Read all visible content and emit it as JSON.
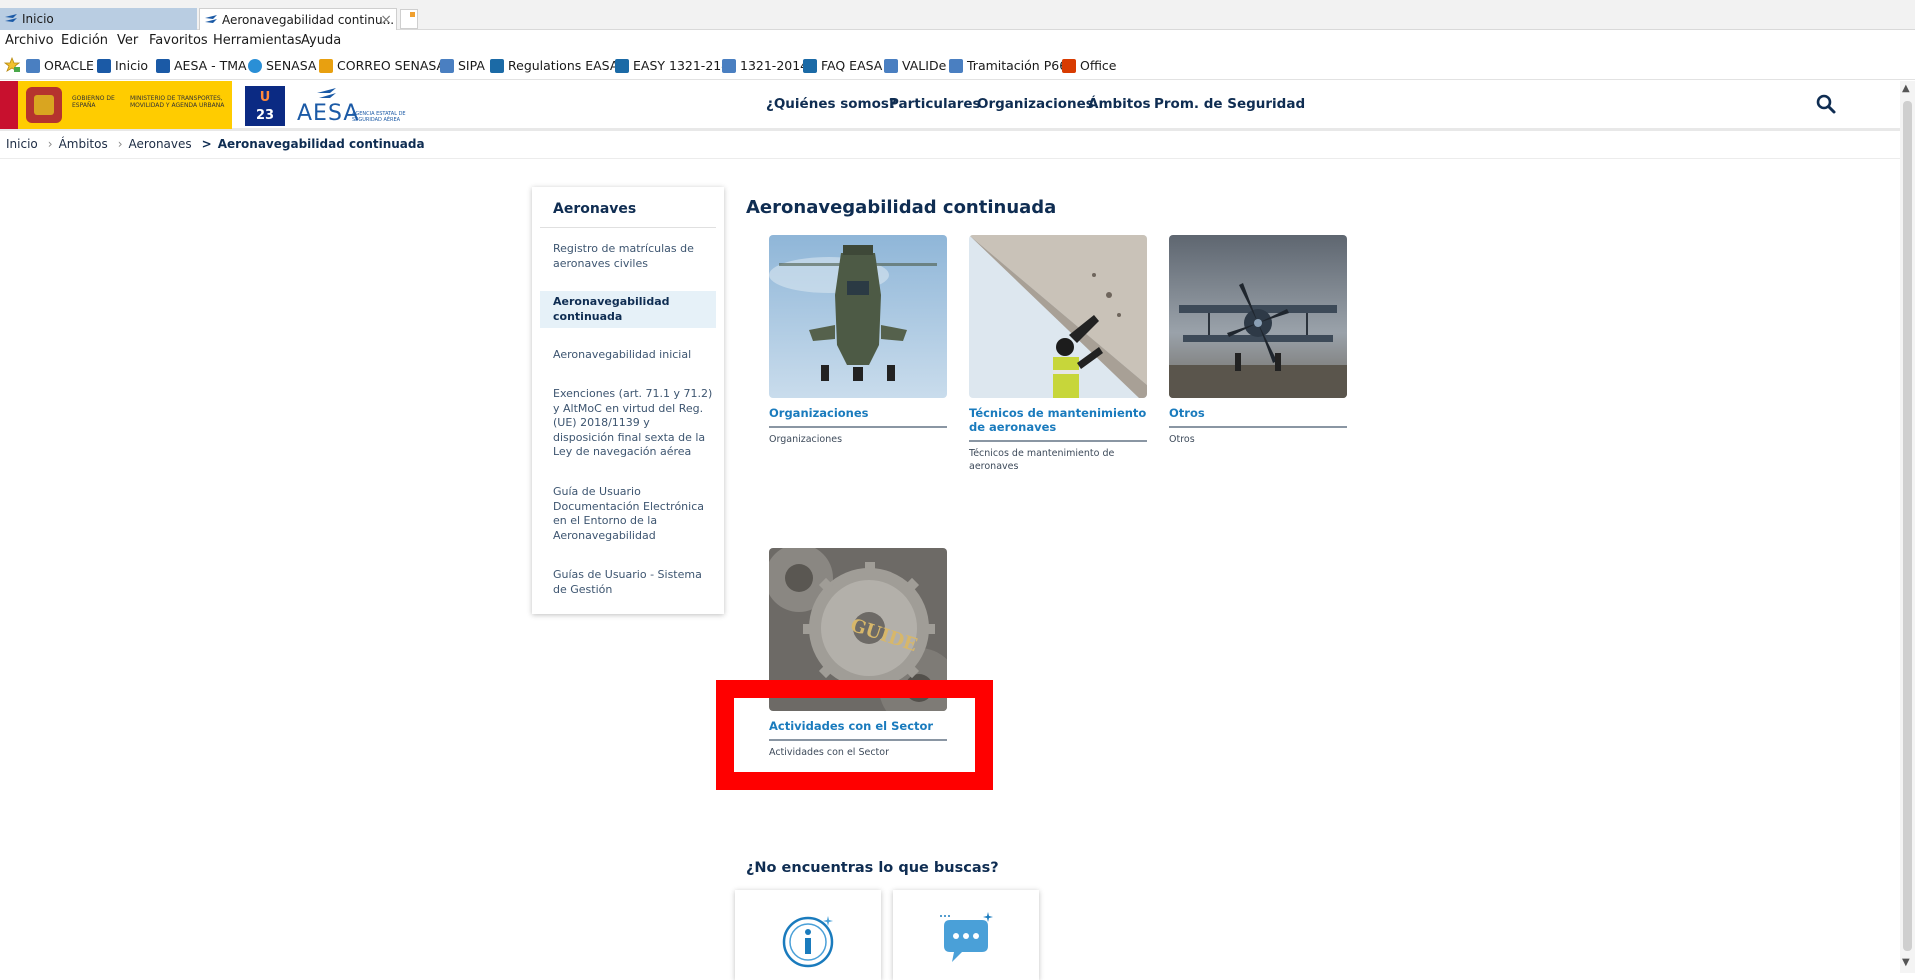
{
  "browser": {
    "tabs": [
      {
        "label": "Inicio"
      },
      {
        "label": "Aeronavegabilidad continu...",
        "close": "×"
      }
    ],
    "menu": [
      "Archivo",
      "Edición",
      "Ver",
      "Favoritos",
      "Herramientas",
      "Ayuda"
    ],
    "favorites": [
      {
        "label": "ORACLE",
        "color": "#4a7fc1"
      },
      {
        "label": "Inicio",
        "color": "#1b5aa6"
      },
      {
        "label": "AESA - TMA",
        "color": "#1b5aa6"
      },
      {
        "label": "SENASA",
        "color": "#2a8fd6"
      },
      {
        "label": "CORREO SENASA",
        "color": "#e8a010"
      },
      {
        "label": "SIPA",
        "color": "#4a7fc1"
      },
      {
        "label": "Regulations  EASA",
        "color": "#1b6aa6"
      },
      {
        "label": "EASY 1321-214",
        "color": "#1b6aa6"
      },
      {
        "label": "1321-2014",
        "color": "#4a7fc1"
      },
      {
        "label": "FAQ EASA",
        "color": "#1b6aa6"
      },
      {
        "label": "VALIDe",
        "color": "#4a7fc1"
      },
      {
        "label": "Tramitación P66",
        "color": "#4a7fc1"
      },
      {
        "label": "Office",
        "color": "#d83b01"
      }
    ]
  },
  "header": {
    "gov_text1": "GOBIERNO DE ESPAÑA",
    "gov_text2": "MINISTERIO DE TRANSPORTES, MOVILIDAD Y AGENDA URBANA",
    "u23_top": "U",
    "u23_bottom": "23",
    "aesa_word": "AESA",
    "aesa_sub": "AGENCIA ESTATAL DE SEGURIDAD AÉREA",
    "nav": [
      "¿Quiénes somos?",
      "Particulares",
      "Organizaciones",
      "Ámbitos",
      "Prom. de Seguridad"
    ]
  },
  "breadcrumb": {
    "items": [
      "Inicio",
      "Ámbitos",
      "Aeronaves"
    ],
    "current": "Aeronavegabilidad continuada",
    "sep1": "›",
    "sep2": "›",
    "sep3": ">"
  },
  "sidebar": {
    "title": "Aeronaves",
    "items": [
      {
        "label": "Registro de matrículas de aeronaves civiles"
      },
      {
        "label": "Aeronavegabilidad continuada",
        "active": true
      },
      {
        "label": "Aeronavegabilidad inicial"
      },
      {
        "label": "Exenciones (art. 71.1 y 71.2) y AltMoC en virtud del Reg. (UE) 2018/1139 y disposición final sexta de la Ley de navegación aérea"
      },
      {
        "label": "Guía de Usuario Documentación Electrónica en el Entorno de la Aeronavegabilidad"
      },
      {
        "label": "Guías de Usuario - Sistema de Gestión"
      }
    ]
  },
  "main": {
    "title": "Aeronavegabilidad continuada",
    "cards": [
      {
        "title": "Organizaciones",
        "desc": "Organizaciones",
        "image": "helicopter"
      },
      {
        "title": "Técnicos de mantenimiento de aeronaves",
        "desc": "Técnicos de mantenimiento de aeronaves",
        "image": "technician"
      },
      {
        "title": "Otros",
        "desc": "Otros",
        "image": "biplane"
      },
      {
        "title": "Actividades con el Sector",
        "desc": "Actividades con el Sector",
        "image": "gears",
        "gear_text": "GUIDE"
      }
    ],
    "help_title": "¿No encuentras lo que buscas?",
    "help_cards": [
      {
        "icon": "info-icon"
      },
      {
        "icon": "chat-icon"
      }
    ]
  },
  "colors": {
    "accent": "#1a7bbd",
    "navy": "#0f2d52",
    "highlight": "#ff0000",
    "gov_yellow": "#ffcc00"
  }
}
